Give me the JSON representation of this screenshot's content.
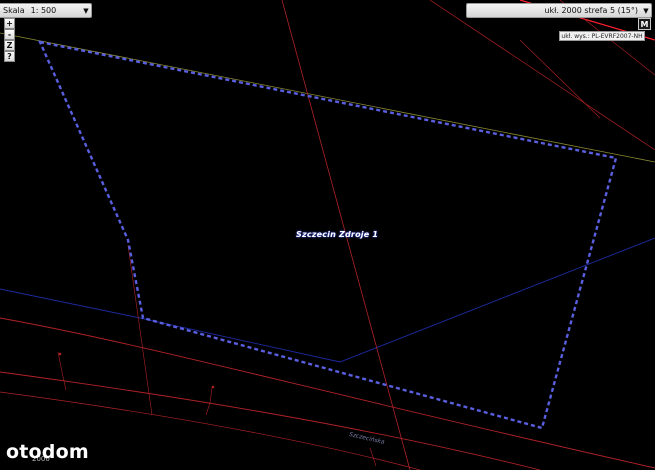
{
  "toolbar": {
    "scale_label": "Skala",
    "scale_value": "1: 500",
    "zoom_in": "+",
    "zoom_out": "-",
    "zoom_extent": "Z",
    "help": "?"
  },
  "crs": {
    "value": "ukł. 2000 strefa 5 (15°)",
    "m_button": "M",
    "height_system": "ukł. wys.: PL-EVRF2007-NH"
  },
  "map": {
    "parcel_label": "Szczecin Zdroje 1",
    "street_label": "Szczecińska",
    "scale_number": "2000",
    "colors": {
      "background": "#000000",
      "parcel_outline": "#5a5fe0",
      "red_lines": "#c0282a",
      "bright_red_line": "#ff2030",
      "blue_line": "#1c2aa0",
      "yellow_line": "#8a8a32"
    }
  },
  "watermark": "otodom"
}
